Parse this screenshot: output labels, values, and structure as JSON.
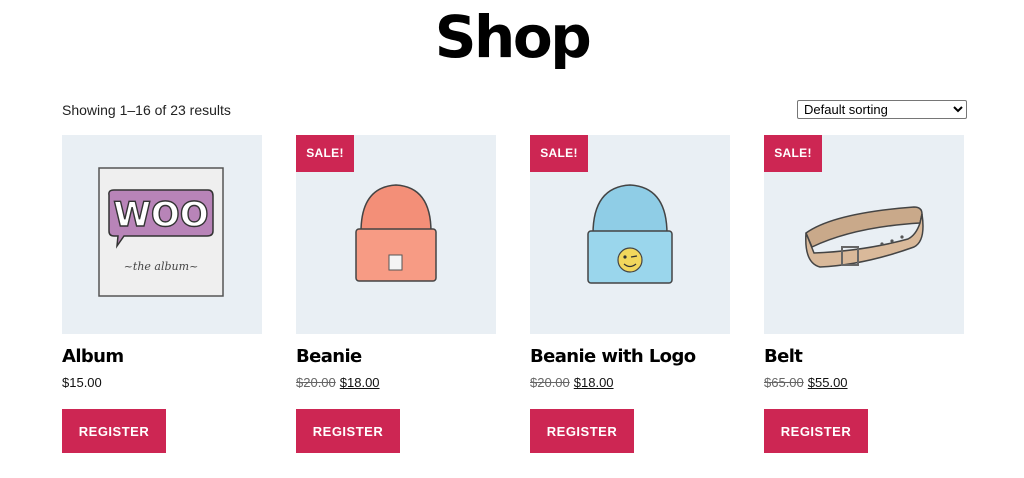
{
  "page": {
    "title": "Shop"
  },
  "toolbar": {
    "result_count": "Showing 1–16 of 23 results",
    "sort_selected": "Default sorting"
  },
  "colors": {
    "accent": "#cd2653",
    "thumb_bg": "#e9eff4"
  },
  "products": [
    {
      "name": "Album",
      "price": "$15.00",
      "old_price": "",
      "sale": false,
      "sale_label": "",
      "button": "REGISTER",
      "image_icon": "album-icon"
    },
    {
      "name": "Beanie",
      "price": "$18.00",
      "old_price": "$20.00",
      "sale": true,
      "sale_label": "SALE!",
      "button": "REGISTER",
      "image_icon": "beanie-icon"
    },
    {
      "name": "Beanie with Logo",
      "price": "$18.00",
      "old_price": "$20.00",
      "sale": true,
      "sale_label": "SALE!",
      "button": "REGISTER",
      "image_icon": "beanie-with-logo-icon"
    },
    {
      "name": "Belt",
      "price": "$55.00",
      "old_price": "$65.00",
      "sale": true,
      "sale_label": "SALE!",
      "button": "REGISTER",
      "image_icon": "belt-icon"
    }
  ],
  "album_art": {
    "logo_text": "WOO",
    "caption": "~the album~"
  }
}
